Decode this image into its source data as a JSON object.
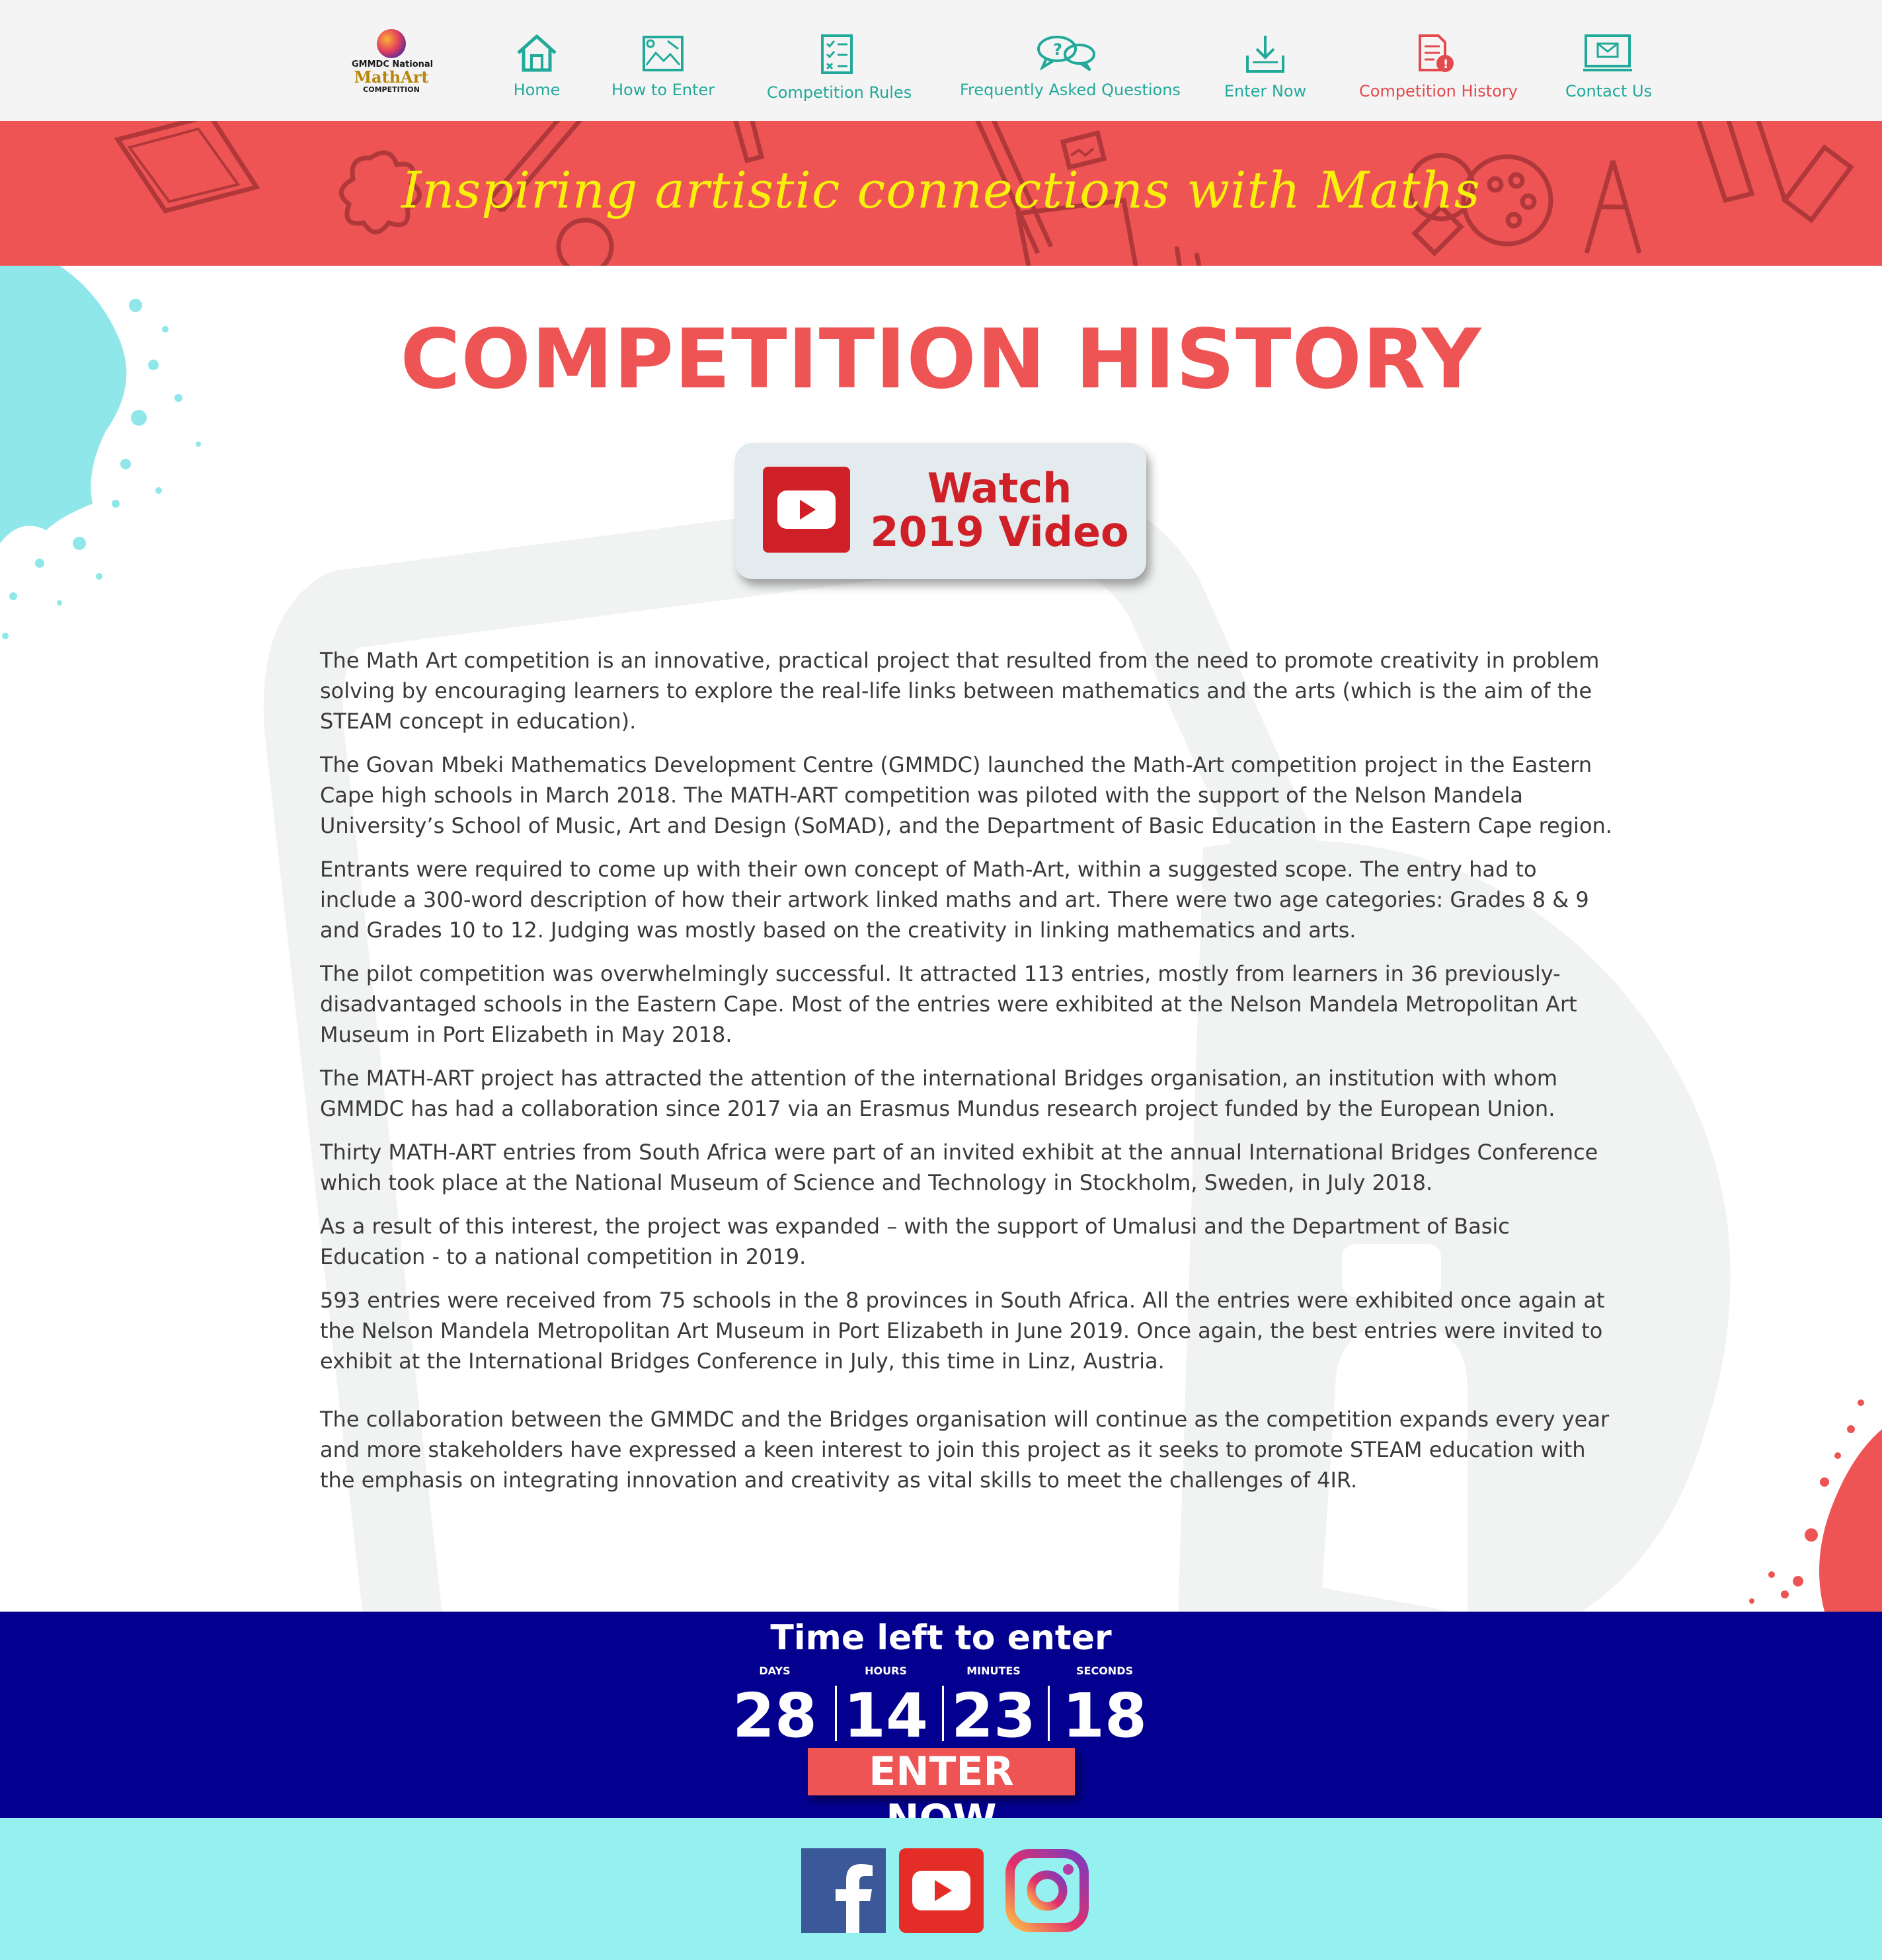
{
  "brand": {
    "logo_line1": "GMMDC National",
    "logo_line2": "MathArt",
    "logo_line3": "COMPETITION"
  },
  "nav": {
    "items": [
      {
        "label": "Home",
        "icon": "home-icon"
      },
      {
        "label": "How to Enter",
        "icon": "drawing-board-icon"
      },
      {
        "label": "Competition Rules",
        "icon": "checklist-icon"
      },
      {
        "label": "Frequently Asked Questions",
        "icon": "chat-bubbles-icon"
      },
      {
        "label": "Enter Now",
        "icon": "download-tray-icon"
      },
      {
        "label": "Competition History",
        "icon": "document-alert-icon",
        "active": true
      },
      {
        "label": "Contact Us",
        "icon": "email-screen-icon"
      }
    ]
  },
  "banner": {
    "tagline": "Inspiring artistic connections with Maths"
  },
  "main": {
    "title": "COMPETITION HISTORY",
    "video_button": {
      "line1": "Watch",
      "line2": "2019 Video",
      "icon": "youtube-play-icon"
    },
    "paragraphs": [
      "The Math Art competition is an innovative, practical project that resulted from the need to promote creativity in problem solving by encouraging learners to explore the real-life links between mathematics and the arts (which is the aim of the STEAM concept in education).",
      "The Govan Mbeki Mathematics Development Centre (GMMDC) launched the Math-Art competition project in the Eastern Cape high schools in March 2018. The MATH-ART competition was piloted with the support of the Nelson Mandela University’s School of Music, Art and Design (SoMAD), and the Department of Basic Education in the Eastern Cape region.",
      "Entrants were required to come up with their own concept of Math-Art, within a suggested scope. The entry had to include a 300-word description of how their artwork linked maths and art.  There were two age categories: Grades 8 & 9 and Grades 10 to 12.  Judging was mostly based on the creativity in linking mathematics and arts.",
      "The pilot competition was overwhelmingly successful.  It attracted 113 entries, mostly from learners in 36 previously-disadvantaged schools in the Eastern Cape.  Most of the entries were exhibited at the Nelson Mandela Metropolitan Art Museum in Port Elizabeth in May 2018.",
      "The MATH-ART project has attracted the attention of the international Bridges organisation, an institution with whom GMMDC has had a collaboration since 2017 via an Erasmus Mundus research project funded by the European Union.",
      "Thirty MATH-ART entries from South Africa were part of an invited exhibit at the annual International Bridges Conference which took place at the National Museum of Science and Technology in Stockholm, Sweden, in July 2018.",
      "As a result of this interest, the project was expanded – with the support of Umalusi and the Department of Basic Education - to a national competition in 2019.",
      "593 entries were received from 75 schools in the 8 provinces in South Africa. All the entries were exhibited once again at the Nelson Mandela Metropolitan Art Museum in Port Elizabeth in June 2019.  Once again, the best entries were invited to exhibit at the International Bridges Conference in July, this time in Linz, Austria.",
      "The collaboration between the GMMDC and the Bridges organisation will continue as the competition expands every year and more stakeholders have expressed a keen interest to join this project as it seeks to promote STEAM education with the emphasis on integrating innovation and creativity as vital skills to meet the challenges of 4IR."
    ]
  },
  "countdown": {
    "title": "Time left to enter",
    "units": [
      {
        "label": "DAYS",
        "value": "28"
      },
      {
        "label": "HOURS",
        "value": "14"
      },
      {
        "label": "MINUTES",
        "value": "23"
      },
      {
        "label": "SECONDS",
        "value": "18"
      }
    ],
    "button": "ENTER NOW"
  },
  "footer": {
    "social": [
      "facebook-icon",
      "youtube-icon",
      "instagram-icon"
    ]
  },
  "colors": {
    "nav_text": "#21a99a",
    "active": "#e34a4e",
    "banner": "#ef5455",
    "tagline": "#f7f10b",
    "countdown_bg": "#03008f",
    "footer_bg": "#95f1f0"
  }
}
